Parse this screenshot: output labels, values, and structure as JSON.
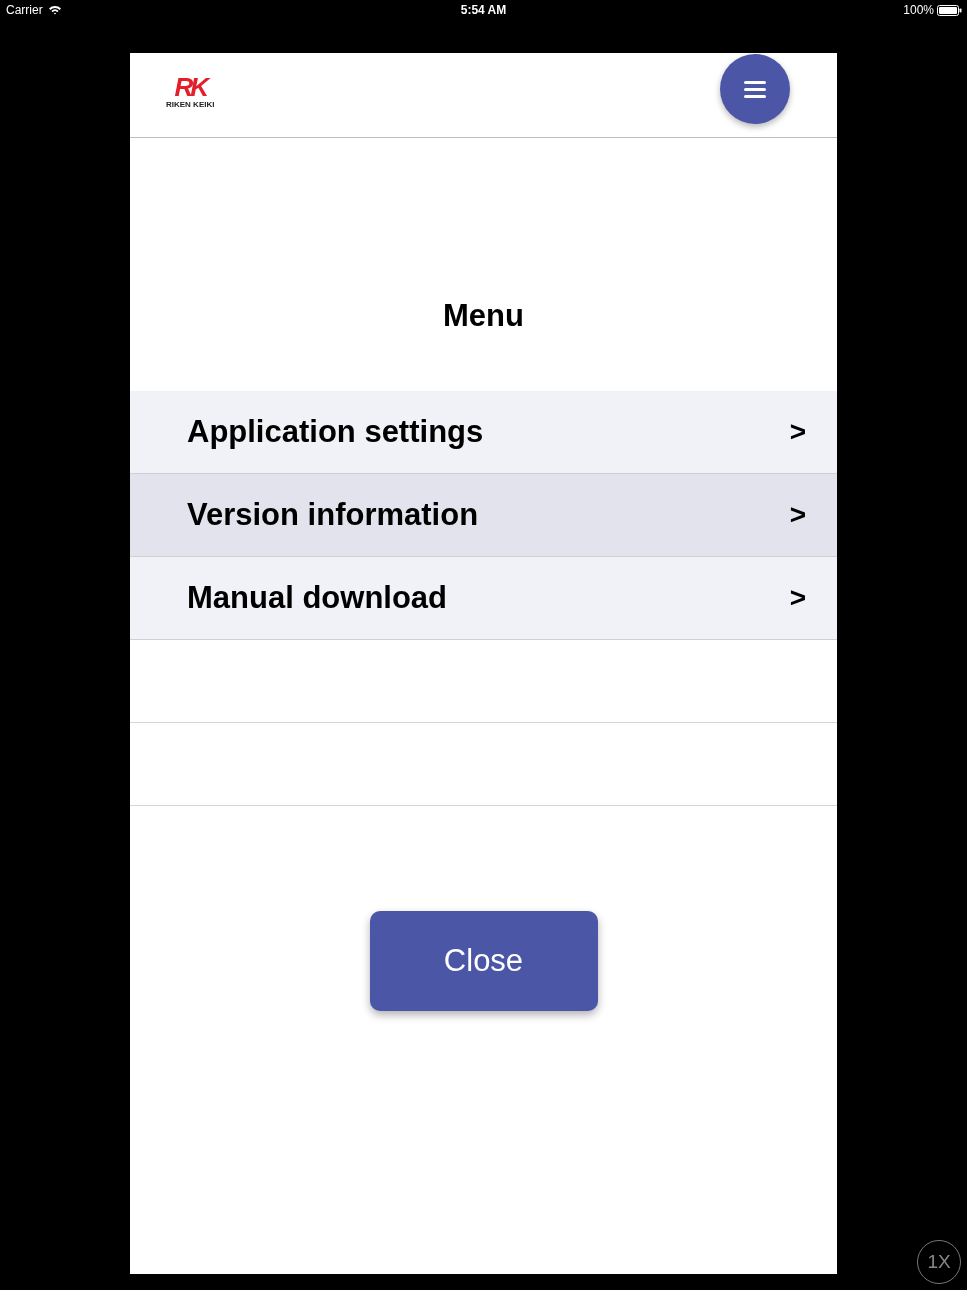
{
  "status_bar": {
    "carrier": "Carrier",
    "time": "5:54 AM",
    "battery": "100%"
  },
  "header": {
    "logo_mark": "RK",
    "logo_text": "RIKEN KEIKI"
  },
  "menu": {
    "title": "Menu",
    "items": [
      {
        "label": "Application settings",
        "chevron": ">",
        "selected": false
      },
      {
        "label": "Version information",
        "chevron": ">",
        "selected": true
      },
      {
        "label": "Manual download",
        "chevron": ">",
        "selected": false
      }
    ]
  },
  "close_button": {
    "label": "Close"
  },
  "zoom_badge": {
    "label": "1X"
  }
}
